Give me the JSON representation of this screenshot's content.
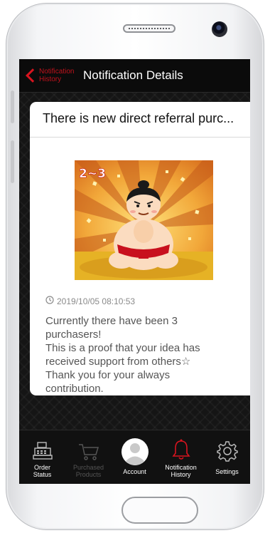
{
  "navbar": {
    "back_label": "Notification History",
    "title": "Notification Details"
  },
  "notification": {
    "title": "There is new direct referral purc...",
    "image_badge": "2~3",
    "timestamp": "2019/10/05 08:10:53",
    "body_lines": [
      "Currently there have been 3",
      "purchasers!",
      "This is a proof that your idea has",
      "received support from others☆",
      "Thank you for your always",
      "contribution."
    ]
  },
  "tabbar": {
    "items": [
      {
        "label_line1": "Order",
        "label_line2": "Status",
        "icon": "cash-register-icon",
        "state": "normal"
      },
      {
        "label_line1": "Purchased",
        "label_line2": "Products",
        "icon": "cart-icon",
        "state": "dim"
      },
      {
        "label_line1": "Account",
        "label_line2": "",
        "icon": "avatar-icon",
        "state": "normal"
      },
      {
        "label_line1": "Notification",
        "label_line2": "History",
        "icon": "bell-icon",
        "state": "active"
      },
      {
        "label_line1": "Settings",
        "label_line2": "",
        "icon": "gear-icon",
        "state": "normal"
      }
    ]
  },
  "colors": {
    "accent": "#d8141f",
    "background": "#151515",
    "card": "#ffffff"
  }
}
